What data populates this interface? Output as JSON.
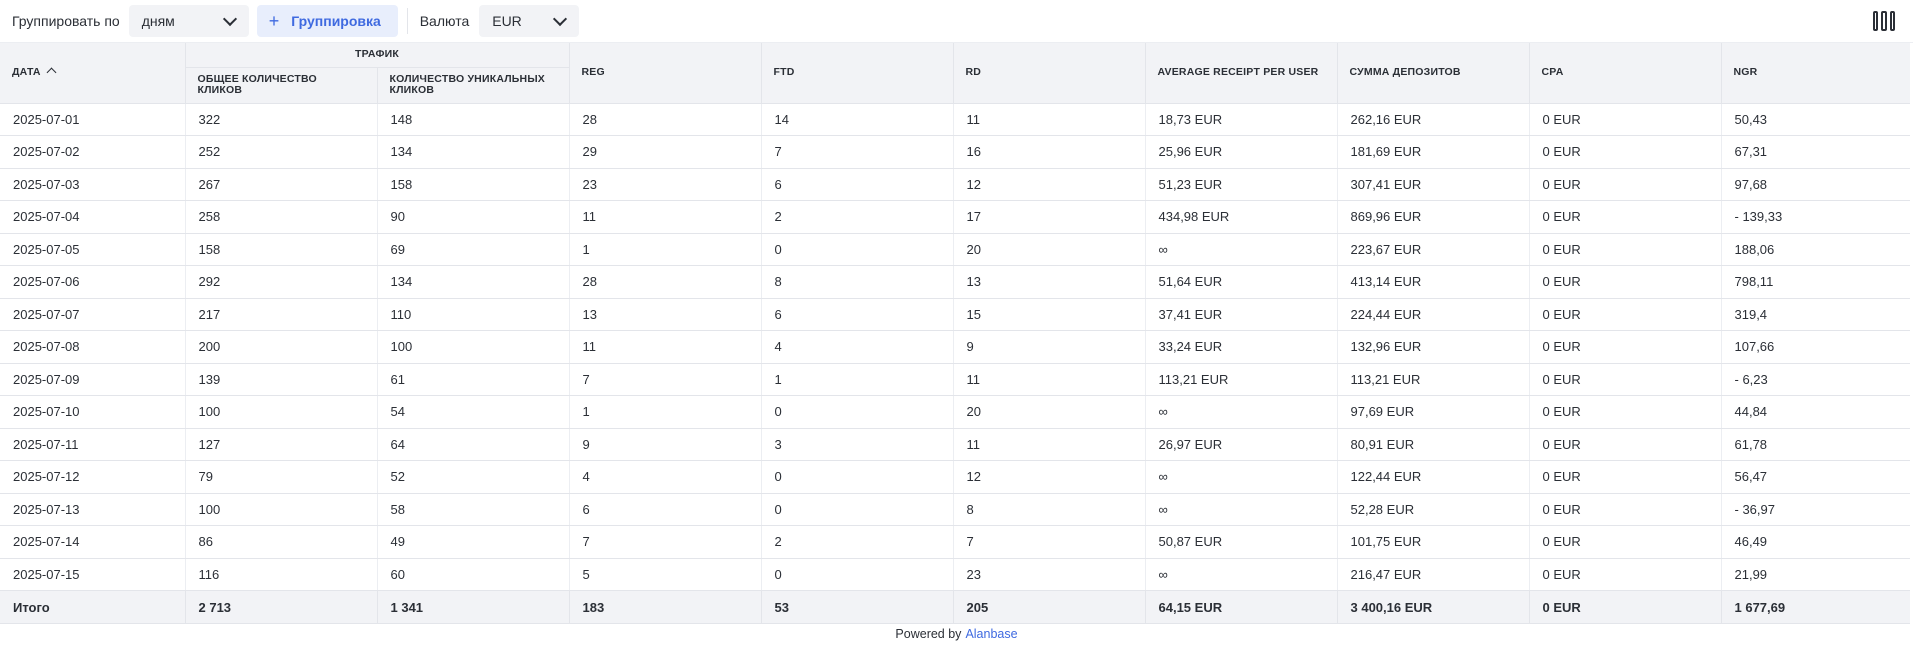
{
  "toolbar": {
    "group_by_label": "Группировать по",
    "group_by_value": "дням",
    "group_button_label": "Группировка",
    "currency_label": "Валюта",
    "currency_value": "EUR",
    "columns_icon": "columns-icon"
  },
  "table": {
    "group_header_traffic": "Трафик",
    "headers": {
      "date": "Дата",
      "clicks_total": "Общее количество кликов",
      "clicks_unique": "Количество уникальных кликов",
      "reg": "REG",
      "ftd": "FTD",
      "rd": "RD",
      "avg_receipt": "Average receipt per user",
      "deposits_sum": "Сумма депозитов",
      "cpa": "CPA",
      "ngr": "NGR"
    },
    "rows": [
      [
        "2025-07-01",
        "322",
        "148",
        "28",
        "14",
        "11",
        "18,73 EUR",
        "262,16 EUR",
        "0 EUR",
        "50,43"
      ],
      [
        "2025-07-02",
        "252",
        "134",
        "29",
        "7",
        "16",
        "25,96 EUR",
        "181,69 EUR",
        "0 EUR",
        "67,31"
      ],
      [
        "2025-07-03",
        "267",
        "158",
        "23",
        "6",
        "12",
        "51,23 EUR",
        "307,41 EUR",
        "0 EUR",
        "97,68"
      ],
      [
        "2025-07-04",
        "258",
        "90",
        "11",
        "2",
        "17",
        "434,98 EUR",
        "869,96 EUR",
        "0 EUR",
        "- 139,33"
      ],
      [
        "2025-07-05",
        "158",
        "69",
        "1",
        "0",
        "20",
        "∞",
        "223,67 EUR",
        "0 EUR",
        "188,06"
      ],
      [
        "2025-07-06",
        "292",
        "134",
        "28",
        "8",
        "13",
        "51,64 EUR",
        "413,14 EUR",
        "0 EUR",
        "798,11"
      ],
      [
        "2025-07-07",
        "217",
        "110",
        "13",
        "6",
        "15",
        "37,41 EUR",
        "224,44 EUR",
        "0 EUR",
        "319,4"
      ],
      [
        "2025-07-08",
        "200",
        "100",
        "11",
        "4",
        "9",
        "33,24 EUR",
        "132,96 EUR",
        "0 EUR",
        "107,66"
      ],
      [
        "2025-07-09",
        "139",
        "61",
        "7",
        "1",
        "11",
        "113,21 EUR",
        "113,21 EUR",
        "0 EUR",
        "- 6,23"
      ],
      [
        "2025-07-10",
        "100",
        "54",
        "1",
        "0",
        "20",
        "∞",
        "97,69 EUR",
        "0 EUR",
        "44,84"
      ],
      [
        "2025-07-11",
        "127",
        "64",
        "9",
        "3",
        "11",
        "26,97 EUR",
        "80,91 EUR",
        "0 EUR",
        "61,78"
      ],
      [
        "2025-07-12",
        "79",
        "52",
        "4",
        "0",
        "12",
        "∞",
        "122,44 EUR",
        "0 EUR",
        "56,47"
      ],
      [
        "2025-07-13",
        "100",
        "58",
        "6",
        "0",
        "8",
        "∞",
        "52,28 EUR",
        "0 EUR",
        "- 36,97"
      ],
      [
        "2025-07-14",
        "86",
        "49",
        "7",
        "2",
        "7",
        "50,87 EUR",
        "101,75 EUR",
        "0 EUR",
        "46,49"
      ],
      [
        "2025-07-15",
        "116",
        "60",
        "5",
        "0",
        "23",
        "∞",
        "216,47 EUR",
        "0 EUR",
        "21,99"
      ]
    ],
    "totals": [
      "Итого",
      "2 713",
      "1 341",
      "183",
      "53",
      "205",
      "64,15 EUR",
      "3 400,16 EUR",
      "0 EUR",
      "1 677,69"
    ]
  },
  "footer": {
    "powered_by": "Powered by",
    "brand": "Alanbase"
  }
}
